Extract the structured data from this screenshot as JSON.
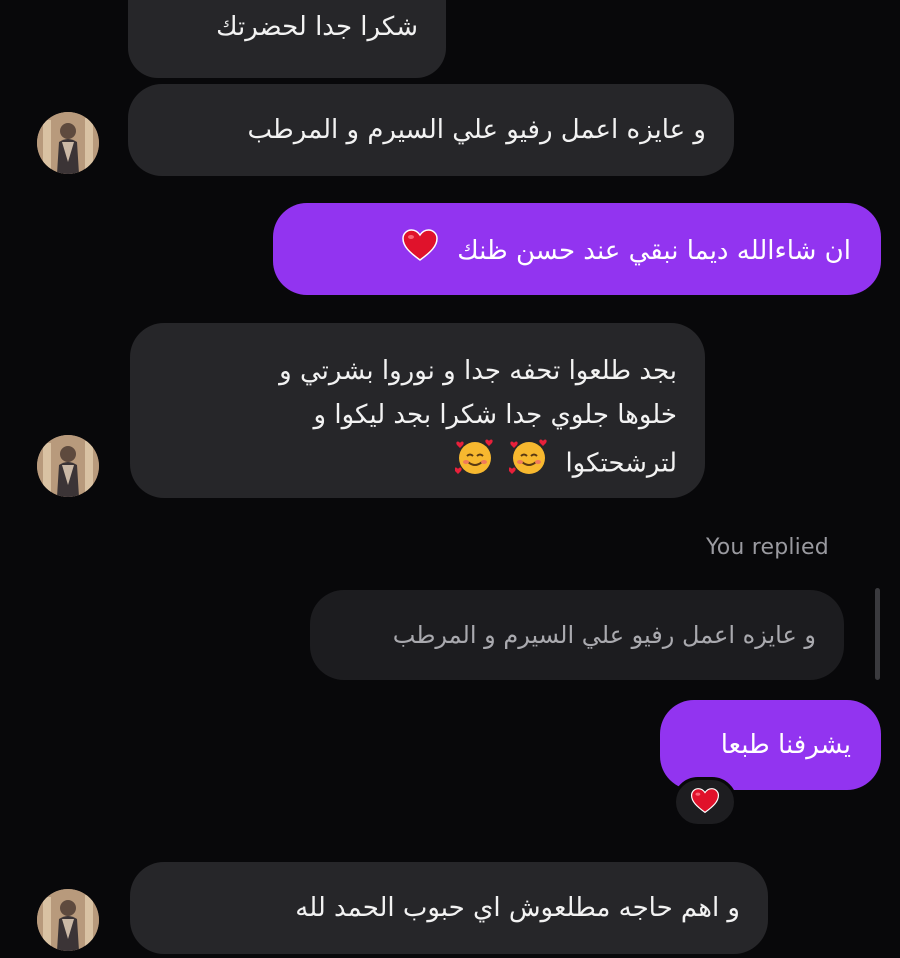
{
  "conversation": {
    "messages": [
      {
        "direction": "incoming",
        "text": "شكرا جدا لحضرتك"
      },
      {
        "direction": "incoming",
        "text": "و عايزه اعمل رفيو علي السيرم و المرطب"
      },
      {
        "direction": "outgoing",
        "text": "ان شاءالله ديما نبقي عند حسن ظنك",
        "emoji": "red-heart"
      },
      {
        "direction": "incoming",
        "lines": [
          "بجد طلعوا تحفه جدا و نوروا بشرتي و",
          "خلوها جلوي جدا شكرا بجد ليكوا و",
          "لترشحتكوا"
        ],
        "emoji": [
          "smiling-face-with-hearts",
          "smiling-face-with-hearts"
        ]
      },
      {
        "direction": "outgoing",
        "replied_label": "You replied",
        "quoted_text": "و عايزه اعمل رفيو علي السيرم و المرطب",
        "text": "يشرفنا طبعا",
        "reaction": "red-heart"
      },
      {
        "direction": "incoming",
        "text": "و اهم حاجه مطلعوش اي حبوب الحمد لله"
      }
    ]
  },
  "colors": {
    "background": "#08080a",
    "incoming_bubble": "#262629",
    "outgoing_bubble": "#9234f0",
    "reaction_bubble": "#1d1d20",
    "muted_text": "#9a9aa0"
  }
}
